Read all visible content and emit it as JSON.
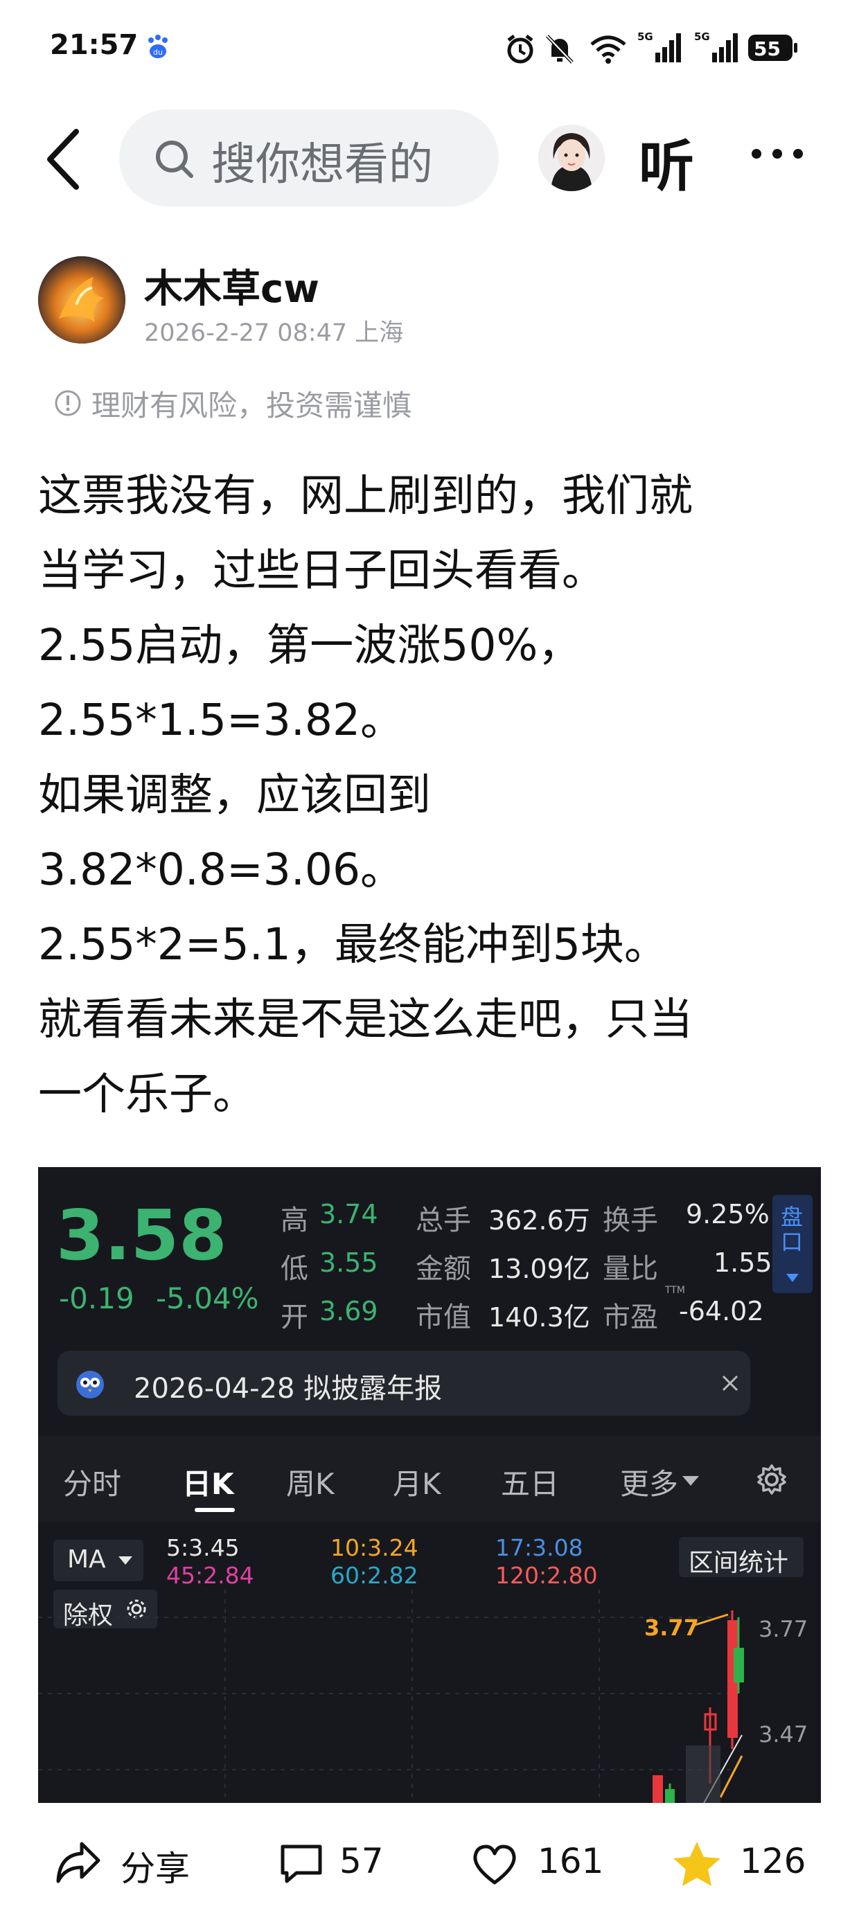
{
  "status_bar": {
    "time": "21:57",
    "network_1": "5G",
    "network_2": "5G",
    "battery": "55",
    "icons": [
      "baidu-app-icon",
      "alarm-icon",
      "mute-icon",
      "wifi-icon",
      "signal-icon",
      "signal-icon",
      "battery-icon"
    ]
  },
  "header": {
    "search_placeholder": "搜你想看的",
    "listen_label": "听",
    "icons": [
      "back-icon",
      "search-icon",
      "more-icon"
    ]
  },
  "post": {
    "author": "木木草cw",
    "meta": "2026-2-27 08:47 上海",
    "risk_notice": "理财有风险，投资需谨慎",
    "lines": [
      "这票我没有，网上刷到的，我们就",
      "当学习，过些日子回头看看。",
      "2.55启动，第一波涨50%，",
      "2.55*1.5=3.82。",
      "如果调整，应该回到",
      "3.82*0.8=3.06。",
      "2.55*2=5.1，最终能冲到5块。",
      "就看看未来是不是这么走吧，只当",
      "一个乐子。"
    ]
  },
  "stock": {
    "price": "3.58",
    "change": "-0.19",
    "change_pct": "-5.04%",
    "quote": {
      "high_label": "高",
      "high": "3.74",
      "low_label": "低",
      "low": "3.55",
      "open_label": "开",
      "open": "3.69",
      "volume_label": "总手",
      "volume": "362.6万",
      "amount_label": "金额",
      "amount": "13.09亿",
      "mktcap_label": "市值",
      "mktcap": "140.3亿",
      "turnover_label": "换手",
      "turnover": "9.25%",
      "vol_ratio_label": "量比",
      "vol_ratio": "1.55",
      "pe_label": "市盈",
      "pe_tag": "TTM",
      "pe": "-64.02"
    },
    "pankou_label": "盘口",
    "notice": "2026-04-28 拟披露年报",
    "tabs": [
      "分时",
      "日K",
      "周K",
      "月K",
      "五日",
      "更多"
    ],
    "active_tab": "日K",
    "ma_label": "MA",
    "ma_values": [
      {
        "text": "5:3.45",
        "color": "#e8e8e8"
      },
      {
        "text": "10:3.24",
        "color": "#f5a623"
      },
      {
        "text": "17:3.08",
        "color": "#4a90e2"
      },
      {
        "text": "45:2.84",
        "color": "#e040a0"
      },
      {
        "text": "60:2.82",
        "color": "#28a8c8"
      },
      {
        "text": "120:2.80",
        "color": "#ff5a5a"
      }
    ],
    "range_stats_label": "区间统计",
    "chuquan_label": "除权",
    "chart_high_label": "3.77",
    "axis_labels": [
      "3.77",
      "3.47"
    ],
    "colors": {
      "up": "#e8383d",
      "down": "#2db34a",
      "background": "#16181d"
    }
  },
  "bottom_bar": {
    "share_label": "分享",
    "comments": "57",
    "likes": "161",
    "favorites": "126",
    "icons": [
      "share-icon",
      "comment-icon",
      "heart-icon",
      "star-icon"
    ]
  }
}
